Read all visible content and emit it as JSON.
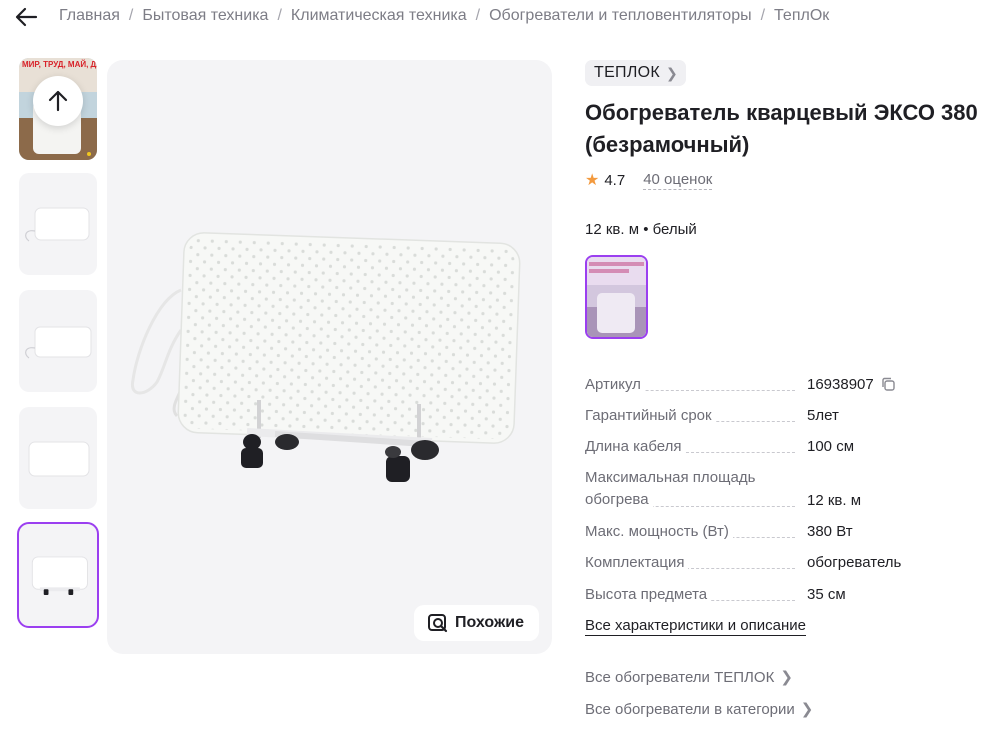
{
  "breadcrumbs": [
    "Главная",
    "Бытовая техника",
    "Климатическая техника",
    "Обогреватели и тепловентиляторы",
    "ТеплОк"
  ],
  "gallery": {
    "thumbnails": [
      "photo",
      "heater-side",
      "heater-front",
      "heater-panel",
      "heater-with-stand"
    ],
    "selected_index": 4,
    "similar_label": "Похожие",
    "thumb_banner_text": "МИР, ТРУД, МАЙ, ДАЮ ОБОГРЕВАТЕЛЬ"
  },
  "product": {
    "brand": "ТЕПЛОК",
    "title": "Обогреватель кварцевый ЭКСО 380 (безрамочный)",
    "rating": "4.7",
    "reviews": "40 оценок",
    "variant": "12 кв. м • белый"
  },
  "specs": [
    {
      "name": "Артикул",
      "value": "16938907",
      "copy": true
    },
    {
      "name": "Гарантийный срок",
      "value": "5лет"
    },
    {
      "name": "Длина кабеля",
      "value": "100 см"
    },
    {
      "name": "Максимальная площадь обогрева",
      "value": "12 кв. м"
    },
    {
      "name": "Макс. мощность (Вт)",
      "value": "380 Вт"
    },
    {
      "name": "Комплектация",
      "value": "обогреватель"
    },
    {
      "name": "Высота предмета",
      "value": "35 см"
    }
  ],
  "links": {
    "all_specs": "Все характеристики и описание",
    "brand_category": "Все обогреватели ТЕПЛОК",
    "category": "Все обогреватели в категории"
  },
  "colors": {
    "accent": "#9b3ff0",
    "star": "#f39a3e",
    "muted": "#6d6d76",
    "surface": "#f4f4f6"
  }
}
